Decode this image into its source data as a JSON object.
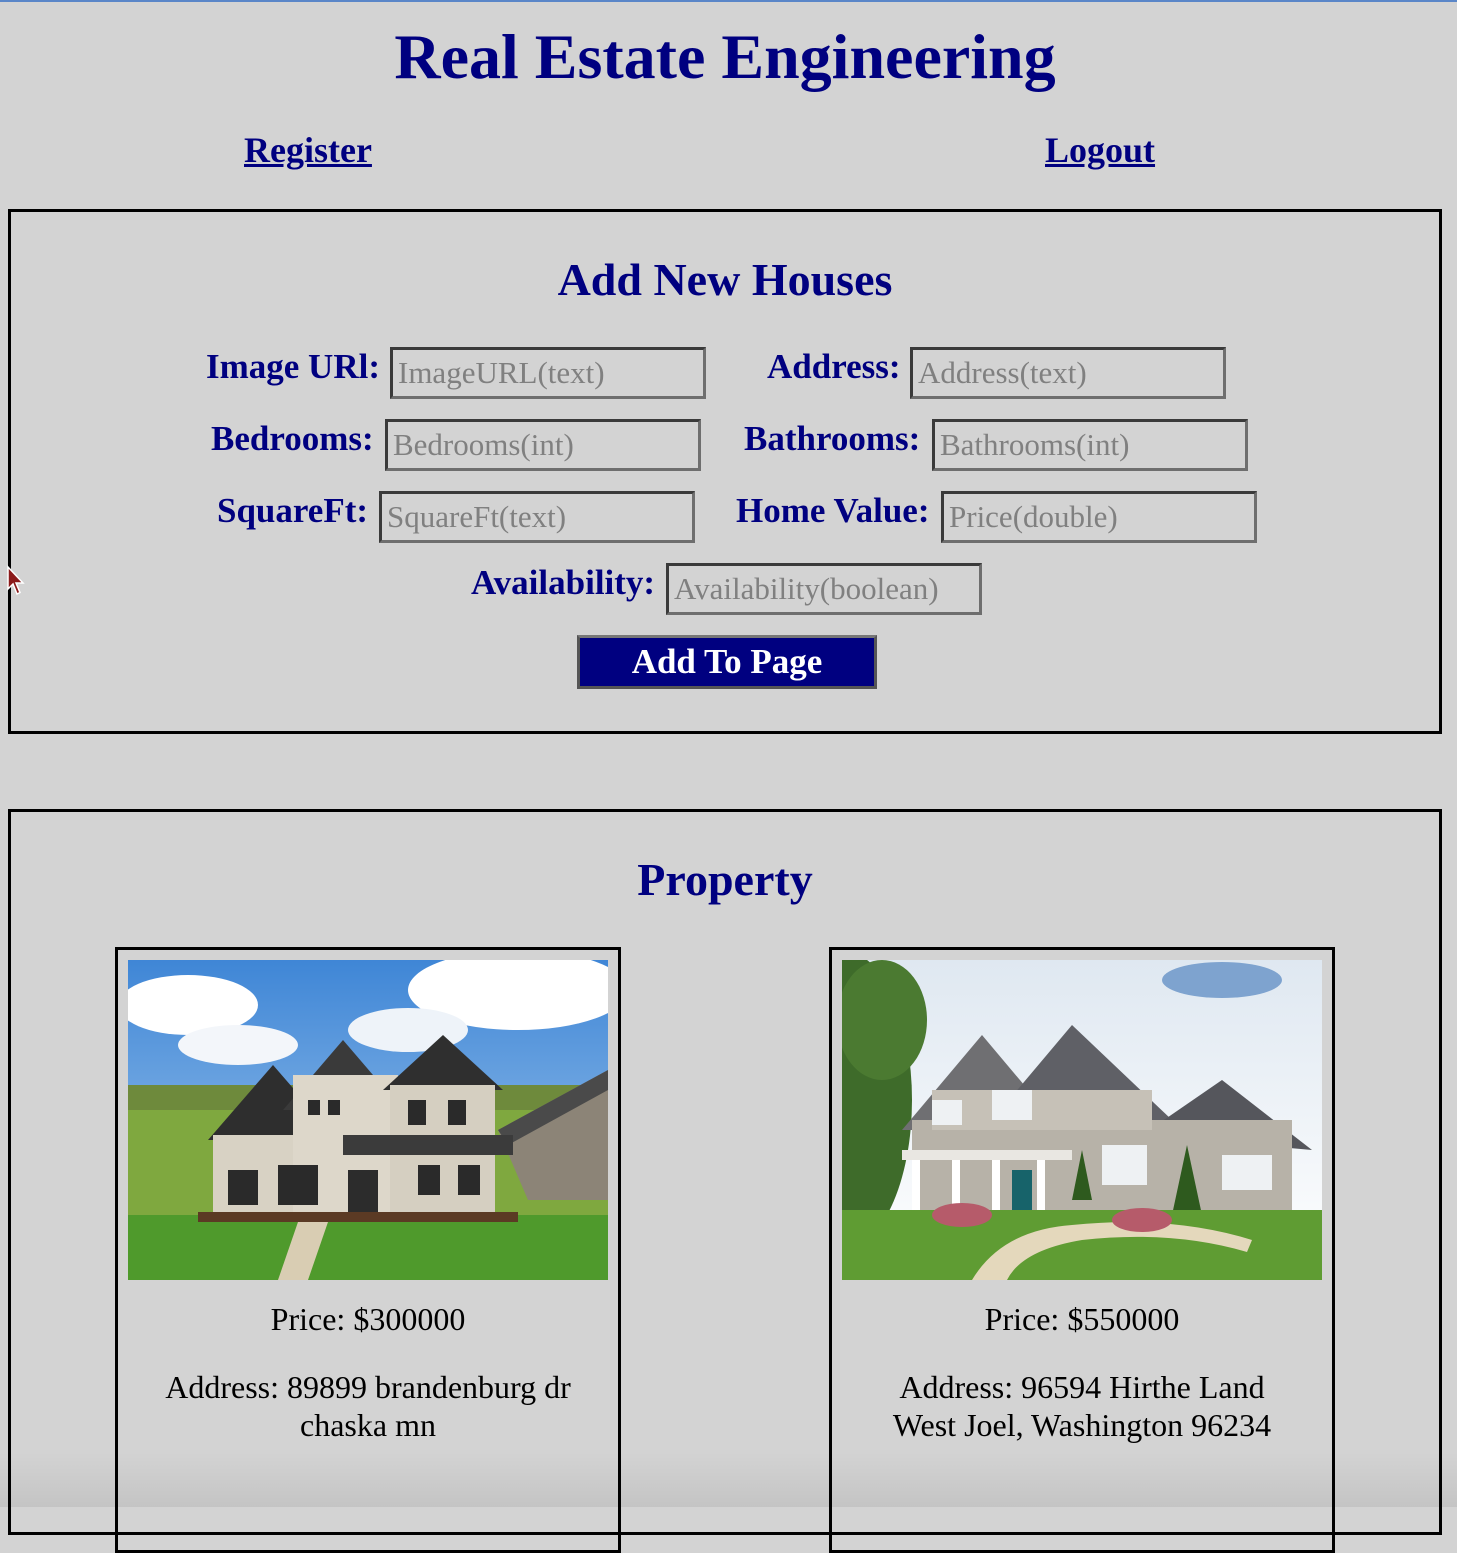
{
  "header": {
    "title": "Real Estate Engineering",
    "nav": {
      "register": "Register",
      "logout": "Logout"
    }
  },
  "form": {
    "heading": "Add New Houses",
    "fields": {
      "image_url": {
        "label": "Image URl:",
        "placeholder": "ImageURL(text)"
      },
      "address": {
        "label": "Address:",
        "placeholder": "Address(text)"
      },
      "bedrooms": {
        "label": "Bedrooms:",
        "placeholder": "Bedrooms(int)"
      },
      "bathrooms": {
        "label": "Bathrooms:",
        "placeholder": "Bathrooms(int)"
      },
      "squareft": {
        "label": "SquareFt:",
        "placeholder": "SquareFt(text)"
      },
      "home_value": {
        "label": "Home Value:",
        "placeholder": "Price(double)"
      },
      "availability": {
        "label": "Availability:",
        "placeholder": "Availability(boolean)"
      }
    },
    "submit_label": "Add To Page"
  },
  "property": {
    "heading": "Property",
    "cards": [
      {
        "price": "Price: $300000",
        "address": "Address: 89899 brandenburg dr chaska mn"
      },
      {
        "price": "Price: $550000",
        "address": "Address: 96594 Hirthe Land West Joel, Washington 96234"
      }
    ]
  },
  "colors": {
    "background": "#d3d3d3",
    "accent": "#000080",
    "top_border": "#5a86c8"
  },
  "icons": {
    "cursor": "mouse-pointer-icon"
  }
}
